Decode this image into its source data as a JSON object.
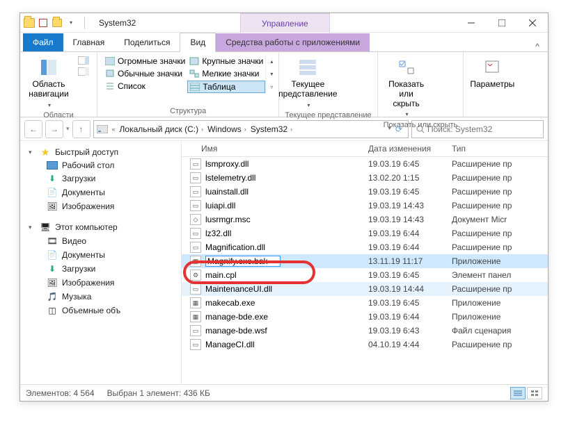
{
  "title": "System32",
  "contextual_tab": "Управление",
  "tabs": {
    "file": "Файл",
    "home": "Главная",
    "share": "Поделиться",
    "view": "Вид",
    "context": "Средства работы с приложениями"
  },
  "ribbon": {
    "panes_group": "Области",
    "nav_pane": "Область навигации",
    "layout_group": "Структура",
    "icons": {
      "huge": "Огромные значки",
      "large": "Крупные значки",
      "medium": "Обычные значки",
      "small": "Мелкие значки",
      "list": "Список",
      "table": "Таблица"
    },
    "current_view_group": "Текущее представление",
    "current_view_btn": "Текущее представление",
    "show_hide_group": "Показать или скрыть",
    "show_hide_btn": "Показать или скрыть",
    "options": "Параметры"
  },
  "breadcrumbs": [
    "Локальный диск (C:)",
    "Windows",
    "System32"
  ],
  "search_placeholder": "Поиск: System32",
  "nav": {
    "quick": "Быстрый доступ",
    "desktop": "Рабочий стол",
    "downloads": "Загрузки",
    "documents": "Документы",
    "pictures": "Изображения",
    "thispc": "Этот компьютер",
    "video": "Видео",
    "documents2": "Документы",
    "downloads2": "Загрузки",
    "pictures2": "Изображения",
    "music": "Музыка",
    "objects3d": "Объемные объ"
  },
  "columns": {
    "name": "Имя",
    "date": "Дата изменения",
    "type": "Тип"
  },
  "files": [
    {
      "name": "lsmproxy.dll",
      "date": "19.03.19 6:45",
      "type": "Расширение пр",
      "icon": "dll"
    },
    {
      "name": "lstelemetry.dll",
      "date": "13.02.20 1:15",
      "type": "Расширение пр",
      "icon": "dll"
    },
    {
      "name": "luainstall.dll",
      "date": "19.03.19 6:45",
      "type": "Расширение пр",
      "icon": "dll"
    },
    {
      "name": "luiapi.dll",
      "date": "19.03.19 14:43",
      "type": "Расширение пр",
      "icon": "dll"
    },
    {
      "name": "lusrmgr.msc",
      "date": "19.03.19 14:43",
      "type": "Документ Micr",
      "icon": "msc"
    },
    {
      "name": "lz32.dll",
      "date": "19.03.19 6:44",
      "type": "Расширение пр",
      "icon": "dll"
    },
    {
      "name": "Magnification.dll",
      "date": "19.03.19 6:44",
      "type": "Расширение пр",
      "icon": "dll"
    },
    {
      "name": "Magnify.exe.bak",
      "date": "13.11.19 11:17",
      "type": "Приложение",
      "icon": "exe",
      "sel": true,
      "rename": true
    },
    {
      "name": "main.cpl",
      "date": "19.03.19 6:45",
      "type": "Элемент панел",
      "icon": "cpl"
    },
    {
      "name": "MaintenanceUI.dll",
      "date": "19.03.19 14:44",
      "type": "Расширение пр",
      "icon": "dll",
      "soft": true
    },
    {
      "name": "makecab.exe",
      "date": "19.03.19 6:45",
      "type": "Приложение",
      "icon": "exe"
    },
    {
      "name": "manage-bde.exe",
      "date": "19.03.19 6:44",
      "type": "Приложение",
      "icon": "exe"
    },
    {
      "name": "manage-bde.wsf",
      "date": "19.03.19 6:43",
      "type": "Файл сценария",
      "icon": "wsf"
    },
    {
      "name": "ManageCI.dll",
      "date": "04.10.19 4:44",
      "type": "Расширение пр",
      "icon": "dll"
    }
  ],
  "status": {
    "count_label": "Элементов:",
    "count": "4 564",
    "sel_label": "Выбран 1 элемент:",
    "sel_size": "436 КБ"
  }
}
